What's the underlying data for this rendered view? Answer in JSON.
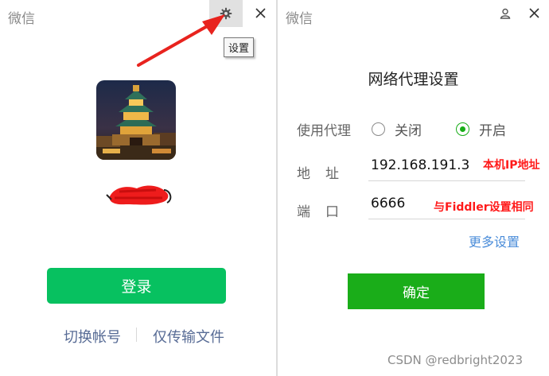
{
  "left": {
    "app_title": "微信",
    "tooltip": "设置",
    "login_label": "登录",
    "switch_account": "切换帐号",
    "transfer_only": "仅传输文件",
    "icons": [
      "gear-icon",
      "close-icon"
    ]
  },
  "right": {
    "app_title": "微信",
    "title": "网络代理设置",
    "proxy_label": "使用代理",
    "option_off": "关闭",
    "option_on": "开启",
    "selected_option": "开启",
    "address_label": "地址",
    "address_value": "192.168.191.3",
    "port_label": "端口",
    "port_value": "6666",
    "more_settings": "更多设置",
    "confirm_label": "确定",
    "icons": [
      "person-icon",
      "close-icon"
    ]
  },
  "annotations": {
    "ip_note": "本机IP地址",
    "port_note": "与Fiddler设置相同"
  },
  "watermark": "CSDN @redbright2023",
  "colors": {
    "login_green": "#07c160",
    "confirm_green": "#1aad19",
    "link_blue": "#576b95",
    "more_blue": "#4a8cd9",
    "annotation_red": "#ff1a1a",
    "arrow_red": "#e8231e"
  }
}
